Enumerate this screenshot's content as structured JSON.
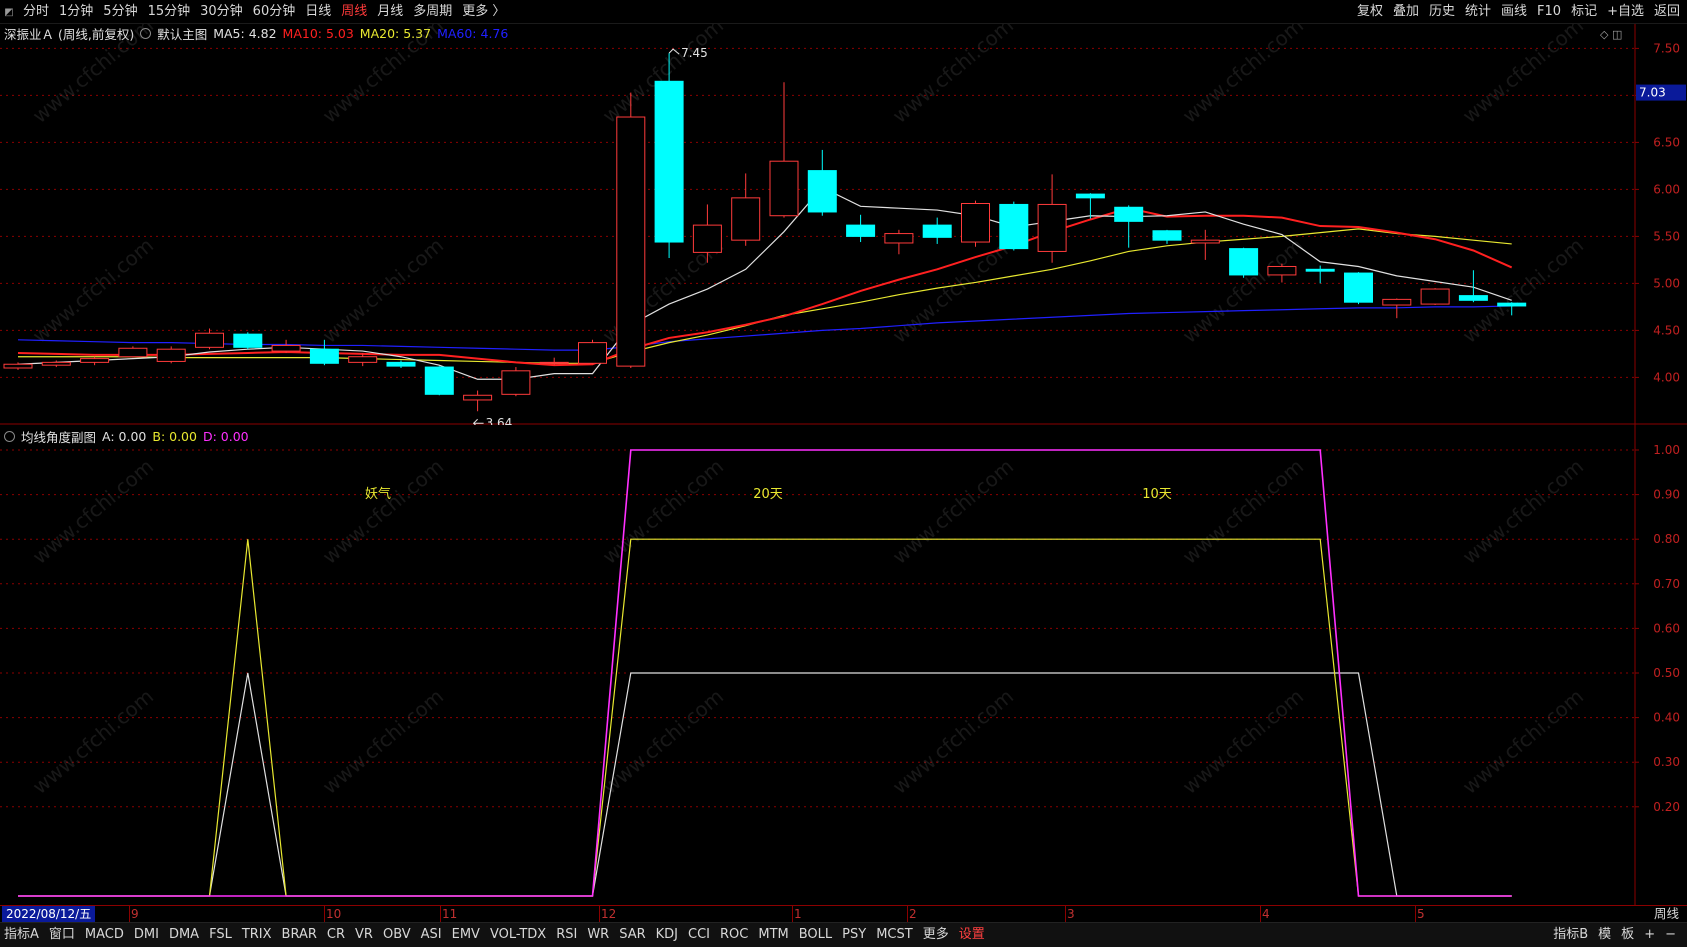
{
  "toolbar": {
    "left": [
      "分时",
      "1分钟",
      "5分钟",
      "15分钟",
      "30分钟",
      "60分钟",
      "日线",
      "周线",
      "月线",
      "多周期",
      "更多 〉"
    ],
    "active": "周线",
    "right": [
      "复权",
      "叠加",
      "历史",
      "统计",
      "画线",
      "F10",
      "标记",
      "+自选",
      "返回"
    ]
  },
  "main_header": {
    "stock": "深振业Ａ (周线,前复权)",
    "template": "默认主图",
    "ma5": "MA5: 4.82",
    "ma10": "MA10: 5.03",
    "ma20": "MA20: 5.37",
    "ma60": "MA60: 4.76"
  },
  "sub_header": {
    "name": "均线角度副图",
    "a": "A: 0.00",
    "b": "B: 0.00",
    "d": "D: 0.00"
  },
  "annotations": {
    "high": "7.45",
    "low": "3.64",
    "sub_texts": [
      "妖气",
      "20天",
      "10天"
    ],
    "watermark": "www.cfchi.com"
  },
  "price_axis": {
    "current": "7.03",
    "labels": [
      "7.50",
      "7.00",
      "6.50",
      "6.00",
      "5.50",
      "5.00",
      "4.50",
      "4.00"
    ]
  },
  "sub_axis": {
    "labels": [
      "1.00",
      "0.90",
      "0.80",
      "0.70",
      "0.60",
      "0.50",
      "0.40",
      "0.30",
      "0.20"
    ]
  },
  "date_strip": {
    "cursor_date": "2022/08/12/五",
    "months": [
      "9",
      "10",
      "11",
      "12",
      "1",
      "2",
      "3",
      "4",
      "5"
    ],
    "period": "周线"
  },
  "tabs": [
    "指标A",
    "窗口",
    "MACD",
    "DMI",
    "DMA",
    "FSL",
    "TRIX",
    "BRAR",
    "CR",
    "VR",
    "OBV",
    "ASI",
    "EMV",
    "VOL-TDX",
    "RSI",
    "WR",
    "SAR",
    "KDJ",
    "CCI",
    "ROC",
    "MTM",
    "BOLL",
    "PSY",
    "MCST",
    "更多",
    "设置"
  ],
  "tabs_right": [
    "指标B",
    "模",
    "板",
    "+",
    "−"
  ],
  "colors": {
    "up": "#ff3b3b",
    "down": "#00ffff",
    "ma5": "#e0e0e0",
    "ma10": "#ff2020",
    "ma20": "#e8e830",
    "ma60": "#2020ff",
    "a_line": "#e8e830",
    "b_line": "#e0e0e0",
    "d_line": "#ff30ff",
    "axis": "#8b0000"
  },
  "chart_data": [
    {
      "type": "candlestick",
      "title": "深振业Ａ (周线,前复权)",
      "ylim": [
        3.6,
        7.6
      ],
      "candles": [
        {
          "o": 4.1,
          "c": 4.14,
          "h": 4.16,
          "l": 4.08
        },
        {
          "o": 4.13,
          "c": 4.16,
          "h": 4.18,
          "l": 4.11
        },
        {
          "o": 4.16,
          "c": 4.2,
          "h": 4.22,
          "l": 4.13
        },
        {
          "o": 4.22,
          "c": 4.31,
          "h": 4.33,
          "l": 4.21
        },
        {
          "o": 4.17,
          "c": 4.3,
          "h": 4.33,
          "l": 4.15
        },
        {
          "o": 4.32,
          "c": 4.47,
          "h": 4.52,
          "l": 4.3
        },
        {
          "o": 4.46,
          "c": 4.32,
          "h": 4.48,
          "l": 4.3
        },
        {
          "o": 4.28,
          "c": 4.34,
          "h": 4.4,
          "l": 4.26
        },
        {
          "o": 4.3,
          "c": 4.15,
          "h": 4.4,
          "l": 4.13
        },
        {
          "o": 4.16,
          "c": 4.22,
          "h": 4.26,
          "l": 4.12
        },
        {
          "o": 4.16,
          "c": 4.12,
          "h": 4.18,
          "l": 4.1
        },
        {
          "o": 4.11,
          "c": 3.82,
          "h": 4.12,
          "l": 3.81
        },
        {
          "o": 3.76,
          "c": 3.81,
          "h": 3.86,
          "l": 3.64
        },
        {
          "o": 3.82,
          "c": 4.07,
          "h": 4.11,
          "l": 3.8
        },
        {
          "o": 4.15,
          "c": 4.16,
          "h": 4.21,
          "l": 4.13
        },
        {
          "o": 4.15,
          "c": 4.37,
          "h": 4.4,
          "l": 4.14
        },
        {
          "o": 4.12,
          "c": 6.77,
          "h": 7.03,
          "l": 4.1
        },
        {
          "o": 7.15,
          "c": 5.44,
          "h": 7.45,
          "l": 5.27
        },
        {
          "o": 5.33,
          "c": 5.62,
          "h": 5.84,
          "l": 5.22
        },
        {
          "o": 5.46,
          "c": 5.91,
          "h": 6.17,
          "l": 5.4
        },
        {
          "o": 5.72,
          "c": 6.3,
          "h": 7.14,
          "l": 5.7
        },
        {
          "o": 6.2,
          "c": 5.76,
          "h": 6.42,
          "l": 5.72
        },
        {
          "o": 5.62,
          "c": 5.5,
          "h": 5.73,
          "l": 5.44
        },
        {
          "o": 5.43,
          "c": 5.53,
          "h": 5.57,
          "l": 5.31
        },
        {
          "o": 5.62,
          "c": 5.49,
          "h": 5.7,
          "l": 5.42
        },
        {
          "o": 5.44,
          "c": 5.85,
          "h": 5.88,
          "l": 5.39
        },
        {
          "o": 5.84,
          "c": 5.37,
          "h": 5.87,
          "l": 5.35
        },
        {
          "o": 5.34,
          "c": 5.84,
          "h": 6.16,
          "l": 5.22
        },
        {
          "o": 5.95,
          "c": 5.91,
          "h": 5.96,
          "l": 5.69
        },
        {
          "o": 5.81,
          "c": 5.66,
          "h": 5.83,
          "l": 5.38
        },
        {
          "o": 5.56,
          "c": 5.46,
          "h": 5.57,
          "l": 5.42
        },
        {
          "o": 5.43,
          "c": 5.46,
          "h": 5.57,
          "l": 5.25
        },
        {
          "o": 5.37,
          "c": 5.09,
          "h": 5.38,
          "l": 5.06
        },
        {
          "o": 5.09,
          "c": 5.18,
          "h": 5.21,
          "l": 5.01
        },
        {
          "o": 5.15,
          "c": 5.13,
          "h": 5.19,
          "l": 5.0
        },
        {
          "o": 5.11,
          "c": 4.8,
          "h": 5.12,
          "l": 4.78
        },
        {
          "o": 4.77,
          "c": 4.83,
          "h": 4.84,
          "l": 4.63
        },
        {
          "o": 4.78,
          "c": 4.94,
          "h": 4.95,
          "l": 4.77
        },
        {
          "o": 4.87,
          "c": 4.82,
          "h": 5.14,
          "l": 4.8
        },
        {
          "o": 4.79,
          "c": 4.76,
          "h": 4.8,
          "l": 4.66
        }
      ],
      "ma5": [
        4.14,
        4.16,
        4.18,
        4.2,
        4.22,
        4.27,
        4.3,
        4.32,
        4.3,
        4.28,
        4.22,
        4.13,
        3.98,
        3.98,
        4.04,
        4.04,
        4.56,
        4.78,
        4.94,
        5.15,
        5.55,
        6.02,
        5.82,
        5.8,
        5.78,
        5.72,
        5.6,
        5.66,
        5.72,
        5.71,
        5.72,
        5.76,
        5.63,
        5.52,
        5.23,
        5.18,
        5.08,
        5.02,
        4.96,
        4.82
      ],
      "ma10": [
        4.26,
        4.25,
        4.24,
        4.24,
        4.24,
        4.25,
        4.26,
        4.27,
        4.26,
        4.25,
        4.24,
        4.24,
        4.2,
        4.16,
        4.13,
        4.14,
        4.3,
        4.42,
        4.48,
        4.56,
        4.65,
        4.78,
        4.92,
        5.04,
        5.15,
        5.28,
        5.4,
        5.55,
        5.68,
        5.8,
        5.71,
        5.72,
        5.72,
        5.7,
        5.61,
        5.6,
        5.54,
        5.47,
        5.35,
        5.17,
        5.03
      ],
      "ma20": [
        4.22,
        4.22,
        4.22,
        4.22,
        4.21,
        4.21,
        4.21,
        4.21,
        4.21,
        4.2,
        4.19,
        4.18,
        4.17,
        4.16,
        4.15,
        4.15,
        4.27,
        4.37,
        4.45,
        4.55,
        4.66,
        4.73,
        4.8,
        4.88,
        4.95,
        5.01,
        5.08,
        5.15,
        5.24,
        5.34,
        5.4,
        5.44,
        5.47,
        5.5,
        5.54,
        5.58,
        5.53,
        5.5,
        5.46,
        5.42,
        5.37
      ],
      "ma60": [
        4.4,
        4.39,
        4.38,
        4.37,
        4.37,
        4.36,
        4.35,
        4.35,
        4.34,
        4.34,
        4.33,
        4.32,
        4.31,
        4.3,
        4.29,
        4.29,
        4.33,
        4.38,
        4.41,
        4.44,
        4.47,
        4.5,
        4.52,
        4.55,
        4.58,
        4.6,
        4.62,
        4.64,
        4.66,
        4.68,
        4.69,
        4.7,
        4.71,
        4.72,
        4.73,
        4.74,
        4.74,
        4.75,
        4.75,
        4.76,
        4.76
      ]
    },
    {
      "type": "line",
      "title": "均线角度副图",
      "ylim": [
        0,
        1.0
      ],
      "series": [
        {
          "name": "A",
          "values": [
            0,
            0,
            0,
            0,
            0,
            0,
            0.8,
            0,
            0,
            0,
            0,
            0,
            0,
            0,
            0,
            0,
            0.8,
            0.8,
            0.8,
            0.8,
            0.8,
            0.8,
            0.8,
            0.8,
            0.8,
            0.8,
            0.8,
            0.8,
            0.8,
            0.8,
            0.8,
            0.8,
            0.8,
            0.8,
            0.8,
            0,
            0,
            0,
            0,
            0,
            0
          ]
        },
        {
          "name": "B",
          "values": [
            0,
            0,
            0,
            0,
            0,
            0,
            0.5,
            0,
            0,
            0,
            0,
            0,
            0,
            0,
            0,
            0,
            0.5,
            0.5,
            0.5,
            0.5,
            0.5,
            0.5,
            0.5,
            0.5,
            0.5,
            0.5,
            0.5,
            0.5,
            0.5,
            0.5,
            0.5,
            0.5,
            0.5,
            0.5,
            0.5,
            0.5,
            0,
            0,
            0,
            0,
            0,
            0
          ]
        },
        {
          "name": "D",
          "values": [
            0,
            0,
            0,
            0,
            0,
            0,
            0,
            0,
            0,
            0,
            0,
            0,
            0,
            0,
            0,
            0,
            1.0,
            1.0,
            1.0,
            1.0,
            1.0,
            1.0,
            1.0,
            1.0,
            1.0,
            1.0,
            1.0,
            1.0,
            1.0,
            1.0,
            1.0,
            1.0,
            1.0,
            1.0,
            1.0,
            0,
            0,
            0,
            0,
            0,
            0
          ]
        }
      ]
    }
  ]
}
